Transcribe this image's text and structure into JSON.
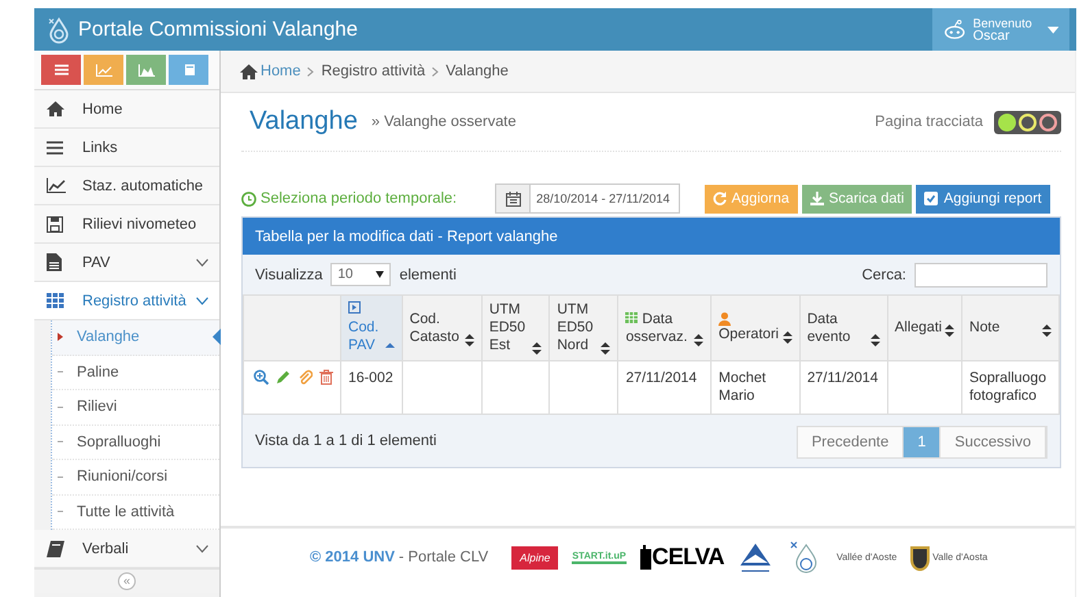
{
  "header": {
    "title": "Portale Commissioni Valanghe",
    "user": {
      "greeting": "Benvenuto",
      "name": "Oscar"
    }
  },
  "sidebar": {
    "shortcuts": [
      {
        "kind": "menu"
      },
      {
        "kind": "chart"
      },
      {
        "kind": "area"
      },
      {
        "kind": "book"
      }
    ],
    "items": [
      {
        "label": "Home",
        "kind": "home",
        "selected": false
      },
      {
        "label": "Links",
        "kind": "list",
        "selected": false
      },
      {
        "label": "Staz. automatiche",
        "kind": "chart",
        "selected": false
      },
      {
        "label": "Rilievi nivometeo",
        "kind": "save",
        "selected": false
      },
      {
        "label": "PAV",
        "kind": "file",
        "expanded": false,
        "selected": false
      },
      {
        "label": "Registro attività",
        "kind": "grid",
        "expanded": true,
        "selected": true,
        "children": [
          {
            "label": "Valanghe",
            "selected": true
          },
          {
            "label": "Paline",
            "selected": false
          },
          {
            "label": "Rilievi",
            "selected": false
          },
          {
            "label": "Sopralluoghi",
            "selected": false
          },
          {
            "label": "Riunioni/corsi",
            "selected": false
          },
          {
            "label": "Tutte le attività",
            "selected": false
          }
        ]
      },
      {
        "label": "Verbali",
        "kind": "book",
        "expanded": false,
        "selected": false
      }
    ],
    "collapse": "«"
  },
  "breadcrumb": [
    "Home",
    "Registro attività",
    "Valanghe"
  ],
  "page": {
    "title": "Valanghe",
    "subtitle": "» Valanghe osservate",
    "tracking": {
      "label": "Pagina tracciata",
      "lights": [
        {
          "color": "#a6e34a",
          "on": true
        },
        {
          "color": "#e8e86a",
          "on": false
        },
        {
          "color": "#f0a0a0",
          "on": false
        }
      ]
    }
  },
  "period": {
    "label": "Seleziona periodo temporale:",
    "value": "28/10/2014 - 27/11/2014"
  },
  "actions": [
    {
      "label": "Aggiorna",
      "kind": "refresh"
    },
    {
      "label": "Scarica dati",
      "kind": "download"
    },
    {
      "label": "Aggiungi report",
      "kind": "add"
    }
  ],
  "table": {
    "title": "Tabella per la modifica dati - Report valanghe",
    "length": {
      "before": "Visualizza",
      "value": "10",
      "after": "elementi"
    },
    "search": {
      "label": "Cerca:"
    },
    "columns": [
      {
        "kind": "actions",
        "sortable": false,
        "sorted": false
      },
      {
        "label": "Cod. PAV",
        "kind": "key",
        "sortable": true,
        "sorted": true
      },
      {
        "label": "Cod. Catasto",
        "kind": "text",
        "sortable": true,
        "sorted": false
      },
      {
        "label": "UTM ED50 Est",
        "kind": "text",
        "sortable": true,
        "sorted": false
      },
      {
        "label": "UTM ED50 Nord",
        "kind": "text",
        "sortable": true,
        "sorted": false
      },
      {
        "label": "Data osservaz.",
        "kind": "date",
        "sortable": true,
        "sorted": false
      },
      {
        "label": "Operatori",
        "kind": "person",
        "sortable": true,
        "sorted": false
      },
      {
        "label": "Data evento",
        "kind": "text",
        "sortable": true,
        "sorted": false
      },
      {
        "label": "Allegati",
        "kind": "text",
        "sortable": true,
        "sorted": false
      },
      {
        "label": "Note",
        "kind": "text",
        "sortable": true,
        "sorted": false
      }
    ],
    "rows": [
      [
        "",
        "16-002",
        "",
        "",
        "",
        "27/11/2014",
        "Mochet Mario",
        "27/11/2014",
        "",
        "Sopralluogo fotografico"
      ]
    ],
    "info": "Vista da 1 a 1 di 1 elementi",
    "pages": [
      {
        "label": "Precedente",
        "selected": false
      },
      {
        "label": "1",
        "selected": true
      },
      {
        "label": "Successivo",
        "selected": false
      }
    ]
  },
  "footer": {
    "copyright": "© 2014 UNV",
    "text": "- Portale CLV",
    "logos": [
      {
        "kind": "alpine",
        "label": "Alpine"
      },
      {
        "kind": "startup",
        "label": "START.it.uP"
      },
      {
        "kind": "celva",
        "label": "CELVA"
      },
      {
        "kind": "mountain"
      },
      {
        "kind": "drop"
      },
      {
        "kind": "region",
        "label": "Vallée d'Aoste"
      },
      {
        "kind": "shield",
        "label": "Valle d'Aosta"
      }
    ]
  }
}
